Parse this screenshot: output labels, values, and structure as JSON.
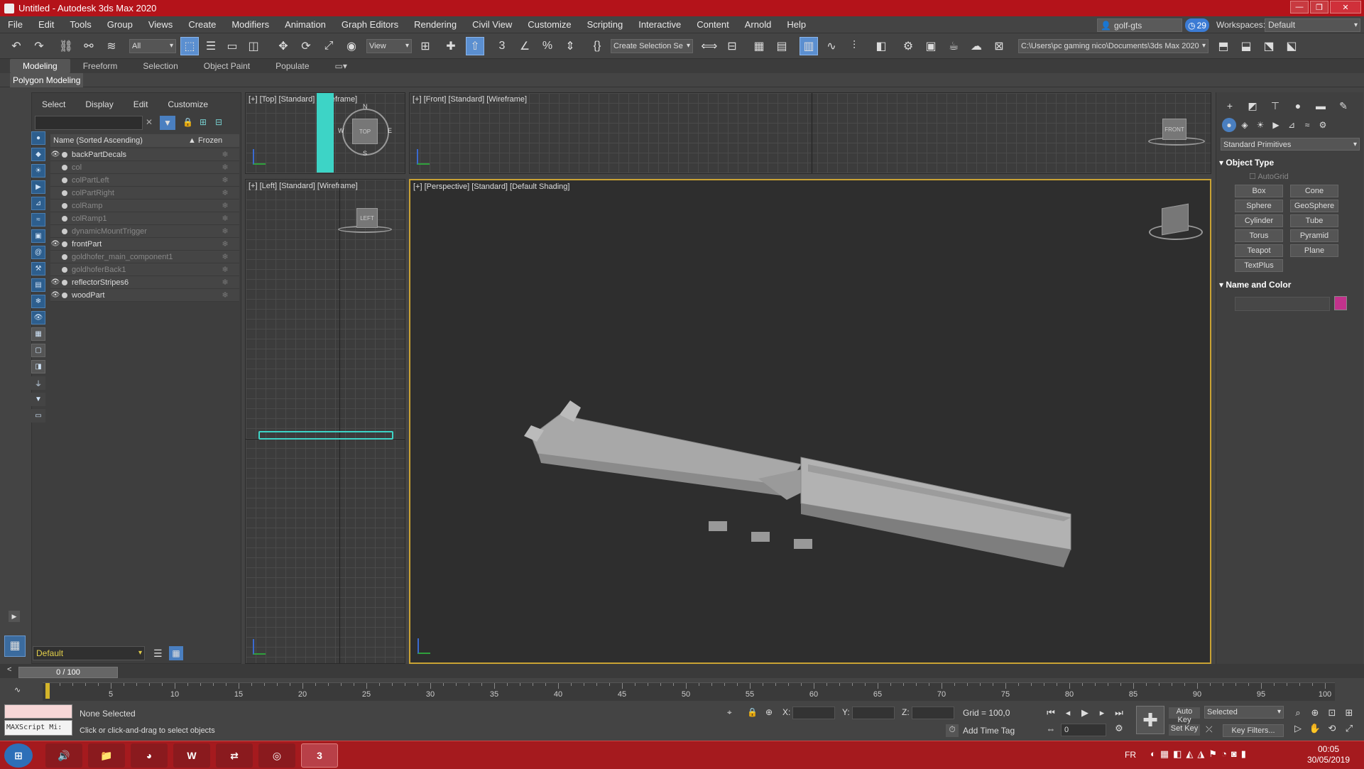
{
  "window": {
    "title": "Untitled - Autodesk 3ds Max 2020"
  },
  "menu": [
    "File",
    "Edit",
    "Tools",
    "Group",
    "Views",
    "Create",
    "Modifiers",
    "Animation",
    "Graph Editors",
    "Rendering",
    "Civil View",
    "Customize",
    "Scripting",
    "Interactive",
    "Content",
    "Arnold",
    "Help"
  ],
  "account": {
    "user": "golf-gts",
    "notifications": "29",
    "workspaces_label": "Workspaces:",
    "workspace": "Default"
  },
  "toolbar": {
    "filter": "All",
    "ref_coord": "View",
    "selection_set": "Create Selection Se",
    "project_path": "C:\\Users\\pc gaming nico\\Documents\\3ds Max 2020"
  },
  "ribbon": {
    "tabs": [
      "Modeling",
      "Freeform",
      "Selection",
      "Object Paint",
      "Populate"
    ],
    "active": "Modeling",
    "panel": "Polygon Modeling"
  },
  "scene_explorer": {
    "tabs": [
      "Select",
      "Display",
      "Edit",
      "Customize"
    ],
    "col_name": "Name (Sorted Ascending)",
    "col_frozen": "▲ Frozen",
    "items": [
      {
        "name": "backPartDecals",
        "visible": true
      },
      {
        "name": "col",
        "visible": false
      },
      {
        "name": "colPartLeft",
        "visible": false
      },
      {
        "name": "colPartRight",
        "visible": false
      },
      {
        "name": "colRamp",
        "visible": false
      },
      {
        "name": "colRamp1",
        "visible": false
      },
      {
        "name": "dynamicMountTrigger",
        "visible": false
      },
      {
        "name": "frontPart",
        "visible": true
      },
      {
        "name": "goldhofer_main_component1",
        "visible": false
      },
      {
        "name": "goldhoferBack1",
        "visible": false
      },
      {
        "name": "reflectorStripes6",
        "visible": true
      },
      {
        "name": "woodPart",
        "visible": true
      }
    ],
    "layer": "Default"
  },
  "viewports": {
    "top": "[+] [Top] [Standard] [Wireframe]",
    "front": "[+] [Front] [Standard] [Wireframe]",
    "left": "[+] [Left] [Standard] [Wireframe]",
    "perspective": "[+] [Perspective] [Standard] [Default Shading]",
    "cube_top": "TOP",
    "cube_front": "FRONT",
    "cube_left": "LEFT",
    "compass": {
      "n": "N",
      "s": "S",
      "e": "E",
      "w": "W"
    }
  },
  "command_panel": {
    "category": "Standard Primitives",
    "object_type": "Object Type",
    "autogrid": "AutoGrid",
    "buttons": [
      "Box",
      "Cone",
      "Sphere",
      "GeoSphere",
      "Cylinder",
      "Tube",
      "Torus",
      "Pyramid",
      "Teapot",
      "Plane",
      "TextPlus"
    ],
    "name_and_color": "Name and Color",
    "color": "#c2328c"
  },
  "timeline": {
    "slider": "0 / 100",
    "ticks": [
      "0",
      "5",
      "10",
      "15",
      "20",
      "25",
      "30",
      "35",
      "40",
      "45",
      "50",
      "55",
      "60",
      "65",
      "70",
      "75",
      "80",
      "85",
      "90",
      "95",
      "100"
    ]
  },
  "status": {
    "maxscript": "MAXScript Mi:",
    "selected": "None Selected",
    "prompt": "Click or click-and-drag to select objects",
    "x_label": "X:",
    "y_label": "Y:",
    "z_label": "Z:",
    "grid": "Grid = 100,0",
    "add_time_tag": "Add Time Tag",
    "auto_key": "Auto Key",
    "set_key": "Set Key",
    "key_mode": "Selected",
    "key_filters": "Key Filters...",
    "frame": "0"
  },
  "taskbar": {
    "lang": "FR",
    "time": "00:05",
    "date": "30/05/2019"
  }
}
